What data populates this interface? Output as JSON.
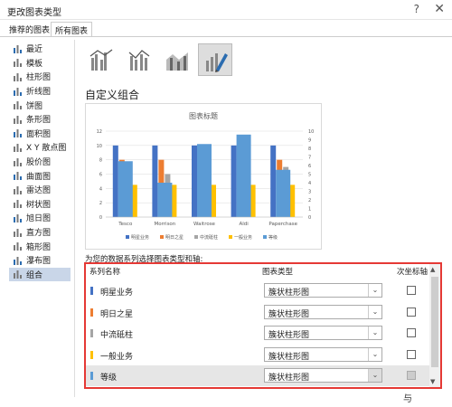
{
  "window": {
    "title": "更改图表类型",
    "help": "?",
    "close": "✕"
  },
  "tabs": [
    "推荐的图表",
    "所有图表"
  ],
  "sidebar": {
    "items": [
      {
        "label": "最近",
        "icon": "recent-icon"
      },
      {
        "label": "模板",
        "icon": "template-icon"
      },
      {
        "label": "柱形图",
        "icon": "column-chart-icon"
      },
      {
        "label": "折线图",
        "icon": "line-chart-icon"
      },
      {
        "label": "饼图",
        "icon": "pie-chart-icon"
      },
      {
        "label": "条形图",
        "icon": "bar-chart-icon"
      },
      {
        "label": "面积图",
        "icon": "area-chart-icon"
      },
      {
        "label": "X Y 散点图",
        "icon": "scatter-chart-icon"
      },
      {
        "label": "股价图",
        "icon": "stock-chart-icon"
      },
      {
        "label": "曲面图",
        "icon": "surface-chart-icon"
      },
      {
        "label": "雷达图",
        "icon": "radar-chart-icon"
      },
      {
        "label": "树状图",
        "icon": "treemap-chart-icon"
      },
      {
        "label": "旭日图",
        "icon": "sunburst-chart-icon"
      },
      {
        "label": "直方图",
        "icon": "histogram-chart-icon"
      },
      {
        "label": "箱形图",
        "icon": "boxwhisker-chart-icon"
      },
      {
        "label": "瀑布图",
        "icon": "waterfall-chart-icon"
      },
      {
        "label": "组合",
        "icon": "combo-chart-icon"
      }
    ],
    "active_index": 16
  },
  "combo_types": [
    {
      "icon": "clustered-column-line-icon"
    },
    {
      "icon": "clustered-column-line-secondary-icon"
    },
    {
      "icon": "stacked-area-clustered-column-icon"
    },
    {
      "icon": "custom-combination-icon"
    }
  ],
  "section_title": "自定义组合",
  "chart_data": {
    "type": "bar",
    "title": "图表标题",
    "categories": [
      "Tesco",
      "Morrison",
      "Waitrose",
      "Aldi",
      "Paperchase"
    ],
    "ylim": [
      0,
      12
    ],
    "yticks": [
      0,
      2,
      4,
      6,
      8,
      10,
      12
    ],
    "y2lim": [
      0,
      10
    ],
    "y2ticks": [
      0,
      1,
      2,
      3,
      4,
      5,
      6,
      7,
      8,
      9,
      10
    ],
    "series": [
      {
        "name": "明星业务",
        "color": "#4472c4",
        "values": [
          10,
          10,
          10,
          10,
          10
        ]
      },
      {
        "name": "明日之星",
        "color": "#ed7d31",
        "values": [
          8,
          8,
          0,
          0,
          8
        ]
      },
      {
        "name": "中流砥柱",
        "color": "#a5a5a5",
        "values": [
          0,
          6,
          0,
          0,
          7
        ]
      },
      {
        "name": "一般业务",
        "color": "#ffc000",
        "values": [
          4.5,
          4.5,
          4.5,
          4.5,
          4.5
        ]
      },
      {
        "name": "等级",
        "color": "#5b9bd5",
        "values": [
          6.5,
          4,
          8.5,
          9.6,
          5.5
        ],
        "secondary": true
      }
    ],
    "legend_position": "bottom"
  },
  "instruction": "为您的数据系列选择图表类型和轴:",
  "grid": {
    "col_name": "系列名称",
    "col_type": "图表类型",
    "col_secondary": "次坐标轴",
    "dropdown_icon": "chevron-down-icon",
    "rows": [
      {
        "name": "明星业务",
        "color": "#4472c4",
        "type": "簇状柱形图",
        "secondary": false
      },
      {
        "name": "明日之星",
        "color": "#ed7d31",
        "type": "簇状柱形图",
        "secondary": false
      },
      {
        "name": "中流砥柱",
        "color": "#a5a5a5",
        "type": "簇状柱形图",
        "secondary": false
      },
      {
        "name": "一般业务",
        "color": "#ffc000",
        "type": "簇状柱形图",
        "secondary": false
      },
      {
        "name": "等级",
        "color": "#5b9bd5",
        "type": "簇状柱形图",
        "secondary": true
      }
    ]
  },
  "footer": {
    "ok_partial": "与"
  }
}
